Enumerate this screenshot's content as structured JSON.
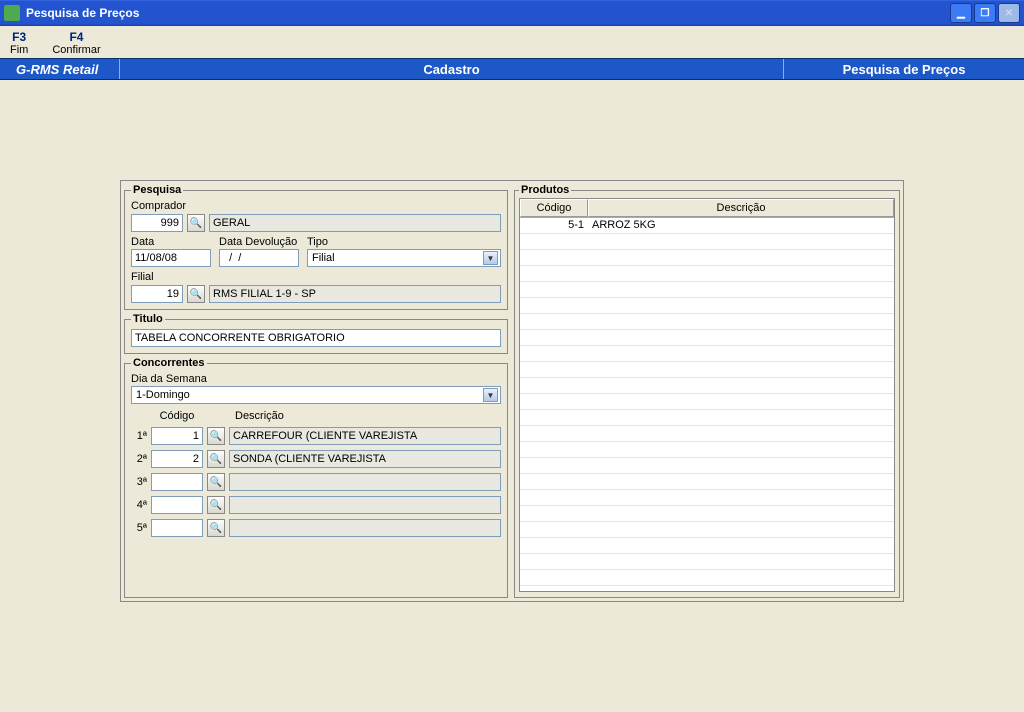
{
  "window": {
    "title": "Pesquisa de Preços"
  },
  "menu": {
    "f3": {
      "key": "F3",
      "label": "Fim"
    },
    "f4": {
      "key": "F4",
      "label": "Confirmar"
    }
  },
  "bluebar": {
    "left": "G-RMS Retail",
    "mid": "Cadastro",
    "right": "Pesquisa de Preços"
  },
  "pesquisa": {
    "legend": "Pesquisa",
    "comprador_label": "Comprador",
    "comprador_code": "999",
    "comprador_desc": "GERAL",
    "data_label": "Data",
    "data_value": "11/08/08",
    "dev_label": "Data Devolução",
    "dev_value": "  /  /",
    "tipo_label": "Tipo",
    "tipo_value": "Filial",
    "filial_label": "Filial",
    "filial_code": "19",
    "filial_desc": "RMS FILIAL 1-9 - SP"
  },
  "titulo": {
    "legend": "Titulo",
    "value": "TABELA CONCORRENTE OBRIGATORIO"
  },
  "concorrentes": {
    "legend": "Concorrentes",
    "dia_label": "Dia da Semana",
    "dia_value": "1-Domingo",
    "codigo_header": "Código",
    "descricao_header": "Descrição",
    "rows": [
      {
        "ord": "1ª",
        "code": "1",
        "desc": "CARREFOUR (CLIENTE VAREJISTA"
      },
      {
        "ord": "2ª",
        "code": "2",
        "desc": "SONDA (CLIENTE VAREJISTA"
      },
      {
        "ord": "3ª",
        "code": "",
        "desc": ""
      },
      {
        "ord": "4ª",
        "code": "",
        "desc": ""
      },
      {
        "ord": "5ª",
        "code": "",
        "desc": ""
      }
    ]
  },
  "produtos": {
    "legend": "Produtos",
    "codigo_header": "Código",
    "descricao_header": "Descrição",
    "rows": [
      {
        "code": "5-1",
        "desc": "ARROZ 5KG"
      }
    ]
  },
  "glyphs": {
    "binoculars": "🔍",
    "minimize": "▁",
    "maximize": "❐",
    "close": "✕",
    "dropdown": "▼"
  }
}
